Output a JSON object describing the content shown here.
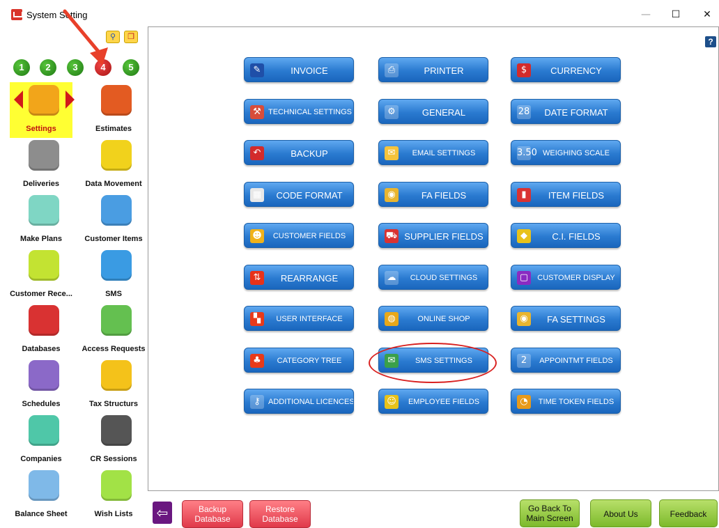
{
  "window": {
    "title": "System Setting",
    "controls": {
      "minimize": "—",
      "maximize": "☐",
      "close": "✕"
    }
  },
  "toolbar": {
    "search_icon": "search-icon",
    "copy_icon": "copy-icon"
  },
  "number_tabs": [
    {
      "label": "1",
      "active": false
    },
    {
      "label": "2",
      "active": false
    },
    {
      "label": "3",
      "active": false
    },
    {
      "label": "4",
      "active": true
    },
    {
      "label": "5",
      "active": false
    }
  ],
  "sidebar": {
    "items": [
      {
        "label": "Settings",
        "icon": "tools-icon",
        "color": "#f2a51a",
        "selected": true
      },
      {
        "label": "Estimates",
        "icon": "estimates-icon",
        "color": "#e35b22"
      },
      {
        "label": "Deliveries",
        "icon": "truck-icon",
        "color": "#8d8d8d"
      },
      {
        "label": "Data Movement",
        "icon": "data-movement-icon",
        "color": "#f1d21c"
      },
      {
        "label": "Make Plans",
        "icon": "clipboard-icon",
        "color": "#7fd6c4"
      },
      {
        "label": "Customer Items",
        "icon": "customer-items-icon",
        "color": "#4a9de2"
      },
      {
        "label": "Customer Rece...",
        "icon": "receipt-icon",
        "color": "#c3e332"
      },
      {
        "label": "SMS",
        "icon": "sms-icon",
        "color": "#3a9be3"
      },
      {
        "label": "Databases",
        "icon": "database-icon",
        "color": "#d93232"
      },
      {
        "label": "Access Requests",
        "icon": "access-icon",
        "color": "#64c050"
      },
      {
        "label": "Schedules",
        "icon": "clock-icon",
        "color": "#8b69c8"
      },
      {
        "label": "Tax Structurs",
        "icon": "tax-icon",
        "color": "#f4c21a"
      },
      {
        "label": "Companies",
        "icon": "home-icon",
        "color": "#4fc7a8"
      },
      {
        "label": "CR Sessions",
        "icon": "cr-sessions-icon",
        "color": "#555555"
      },
      {
        "label": "Balance Sheet",
        "icon": "chart-icon",
        "color": "#7fb9e8"
      },
      {
        "label": "Wish Lists",
        "icon": "checklist-icon",
        "color": "#a2e246"
      }
    ]
  },
  "settings_buttons": [
    {
      "label": "INVOICE",
      "icon": "invoice-icon",
      "icon_color": "#1f4fa8",
      "glyph": "✎"
    },
    {
      "label": "PRINTER",
      "icon": "printer-icon",
      "icon_color": "#ffffff",
      "glyph": "⎙"
    },
    {
      "label": "CURRENCY",
      "icon": "dollar-icon",
      "icon_color": "#d32b2b",
      "glyph": "$"
    },
    {
      "label": "TECHNICAL SETTINGS",
      "icon": "technical-settings-icon",
      "icon_color": "#d84d3a",
      "glyph": "⚒",
      "small": true
    },
    {
      "label": "GENERAL",
      "icon": "gear-icon",
      "icon_color": "#ffffff",
      "glyph": "⚙"
    },
    {
      "label": "DATE FORMAT",
      "icon": "calendar-icon",
      "icon_color": "#ffffff",
      "glyph": "28"
    },
    {
      "label": "BACKUP",
      "icon": "undo-icon",
      "icon_color": "#d32b2b",
      "glyph": "↶"
    },
    {
      "label": "EMAIL SETTINGS",
      "icon": "email-icon",
      "icon_color": "#f5c33b",
      "glyph": "✉",
      "small": true
    },
    {
      "label": "WEIGHING SCALE",
      "icon": "scale-icon",
      "icon_color": "#ffffff",
      "glyph": "3.50",
      "small": true
    },
    {
      "label": "CODE FORMAT",
      "icon": "barcode-icon",
      "icon_color": "#e8e8e8",
      "glyph": "▦"
    },
    {
      "label": "FA FIELDS",
      "icon": "coins-icon",
      "icon_color": "#e9b52f",
      "glyph": "◉"
    },
    {
      "label": "ITEM FIELDS",
      "icon": "item-fields-icon",
      "icon_color": "#d93232",
      "glyph": "▮"
    },
    {
      "label": "CUSTOMER FIELDS",
      "icon": "customers-icon",
      "icon_color": "#f0b21a",
      "glyph": "☻",
      "small": true
    },
    {
      "label": "SUPPLIER FIELDS",
      "icon": "truck-icon",
      "icon_color": "#d93232",
      "glyph": "⛟"
    },
    {
      "label": "C.I. FIELDS",
      "icon": "shapes-icon",
      "icon_color": "#e8c21a",
      "glyph": "◆"
    },
    {
      "label": "REARRANGE",
      "icon": "rearrange-icon",
      "icon_color": "#e8321a",
      "glyph": "⇅"
    },
    {
      "label": "CLOUD SETTINGS",
      "icon": "cloud-icon",
      "icon_color": "#ffffff",
      "glyph": "☁",
      "small": true
    },
    {
      "label": "CUSTOMER DISPLAY",
      "icon": "display-icon",
      "icon_color": "#8a2bc2",
      "glyph": "▢",
      "small": true
    },
    {
      "label": "USER INTERFACE",
      "icon": "user-interface-icon",
      "icon_color": "#e83a1a",
      "glyph": "▚",
      "small": true
    },
    {
      "label": "ONLINE SHOP",
      "icon": "globe-icon",
      "icon_color": "#e8a81a",
      "glyph": "◍",
      "small": true
    },
    {
      "label": "FA SETTINGS",
      "icon": "coins-settings-icon",
      "icon_color": "#e9b52f",
      "glyph": "◉"
    },
    {
      "label": "CATEGORY TREE",
      "icon": "tree-icon",
      "icon_color": "#e83a1a",
      "glyph": "♣",
      "small": true
    },
    {
      "label": "SMS SETTINGS",
      "icon": "sms-settings-icon",
      "icon_color": "#3aa04a",
      "glyph": "✉",
      "small": true
    },
    {
      "label": "APPOINTMT FIELDS",
      "icon": "appointment-icon",
      "icon_color": "#ffffff",
      "glyph": "2",
      "small": true
    },
    {
      "label": "ADDITIONAL LICENCES",
      "icon": "key-icon",
      "icon_color": "#ffffff",
      "glyph": "⚷",
      "small": true
    },
    {
      "label": "EMPLOYEE FIELDS",
      "icon": "employee-icon",
      "icon_color": "#e8c21a",
      "glyph": "☺",
      "small": true
    },
    {
      "label": "TIME TOKEN FIELDS",
      "icon": "clock-icon",
      "icon_color": "#e89a1a",
      "glyph": "◔",
      "small": true
    }
  ],
  "help_label": "?",
  "bottom": {
    "back_glyph": "⇦",
    "backup_database": [
      "Backup",
      "Database"
    ],
    "restore_database": [
      "Restore",
      "Database"
    ],
    "go_back": [
      "Go Back To",
      "Main Screen"
    ],
    "about_us": "About Us",
    "feedback": "Feedback"
  }
}
